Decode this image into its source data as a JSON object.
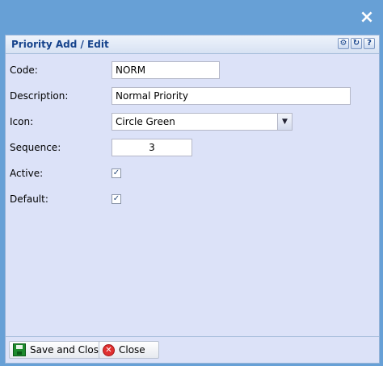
{
  "window": {
    "close_glyph": "×"
  },
  "panel": {
    "title": "Priority Add / Edit",
    "tools": [
      "gear-icon",
      "refresh-icon",
      "help-icon"
    ]
  },
  "form": {
    "code": {
      "label": "Code:",
      "value": "NORM"
    },
    "description": {
      "label": "Description:",
      "value": "Normal Priority"
    },
    "icon": {
      "label": "Icon:",
      "value": "Circle Green"
    },
    "sequence": {
      "label": "Sequence:",
      "value": "3"
    },
    "active": {
      "label": "Active:",
      "checked": true
    },
    "default": {
      "label": "Default:",
      "checked": true
    }
  },
  "footer": {
    "save_label": "Save and Close",
    "close_label": "Close"
  }
}
